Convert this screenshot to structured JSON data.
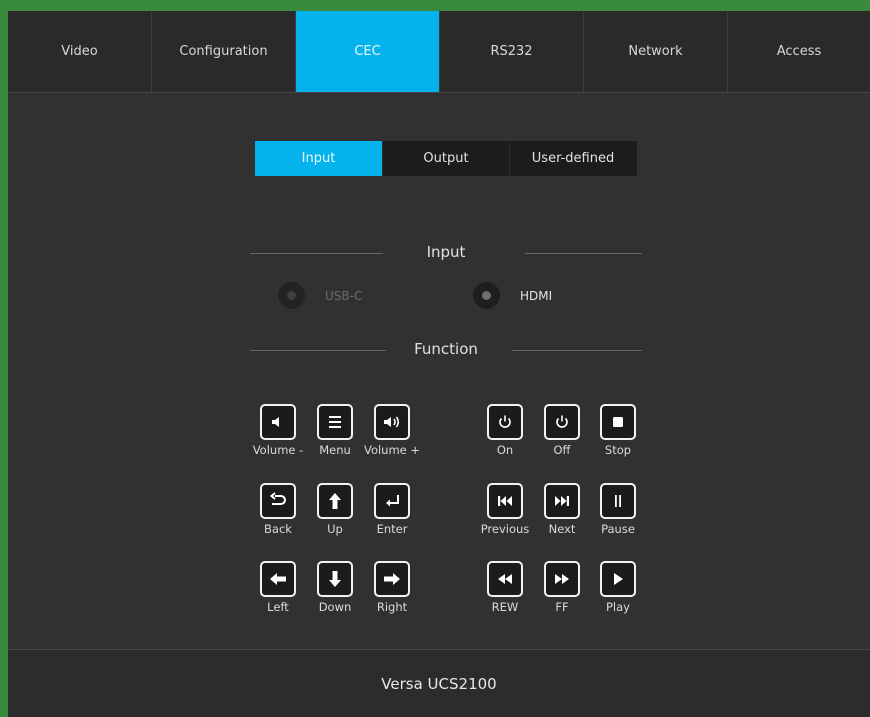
{
  "nav": {
    "tabs": [
      {
        "label": "Video"
      },
      {
        "label": "Configuration"
      },
      {
        "label": "CEC"
      },
      {
        "label": "RS232"
      },
      {
        "label": "Network"
      },
      {
        "label": "Access"
      }
    ],
    "active": "CEC"
  },
  "subtabs": {
    "items": [
      {
        "label": "Input"
      },
      {
        "label": "Output"
      },
      {
        "label": "User-defined"
      }
    ],
    "active": "Input"
  },
  "input_section": {
    "title": "Input",
    "options": [
      {
        "label": "USB-C",
        "selected": false
      },
      {
        "label": "HDMI",
        "selected": true
      }
    ]
  },
  "function_section": {
    "title": "Function",
    "buttons": [
      {
        "label": "Volume -",
        "icon": "volume-down-icon"
      },
      {
        "label": "Menu",
        "icon": "menu-icon"
      },
      {
        "label": "Volume +",
        "icon": "volume-up-icon"
      },
      {
        "label": "On",
        "icon": "power-on-icon"
      },
      {
        "label": "Off",
        "icon": "power-off-icon"
      },
      {
        "label": "Stop",
        "icon": "stop-icon"
      },
      {
        "label": "Back",
        "icon": "back-icon"
      },
      {
        "label": "Up",
        "icon": "arrow-up-icon"
      },
      {
        "label": "Enter",
        "icon": "enter-icon"
      },
      {
        "label": "Previous",
        "icon": "previous-icon"
      },
      {
        "label": "Next",
        "icon": "next-icon"
      },
      {
        "label": "Pause",
        "icon": "pause-icon"
      },
      {
        "label": "Left",
        "icon": "arrow-left-icon"
      },
      {
        "label": "Down",
        "icon": "arrow-down-icon"
      },
      {
        "label": "Right",
        "icon": "arrow-right-icon"
      },
      {
        "label": "REW",
        "icon": "rewind-icon"
      },
      {
        "label": "FF",
        "icon": "fast-forward-icon"
      },
      {
        "label": "Play",
        "icon": "play-icon"
      }
    ]
  },
  "footer": {
    "product": "Versa UCS2100"
  },
  "colors": {
    "accent": "#05b3ec",
    "background": "#313131",
    "frame": "#3a8a3e"
  }
}
